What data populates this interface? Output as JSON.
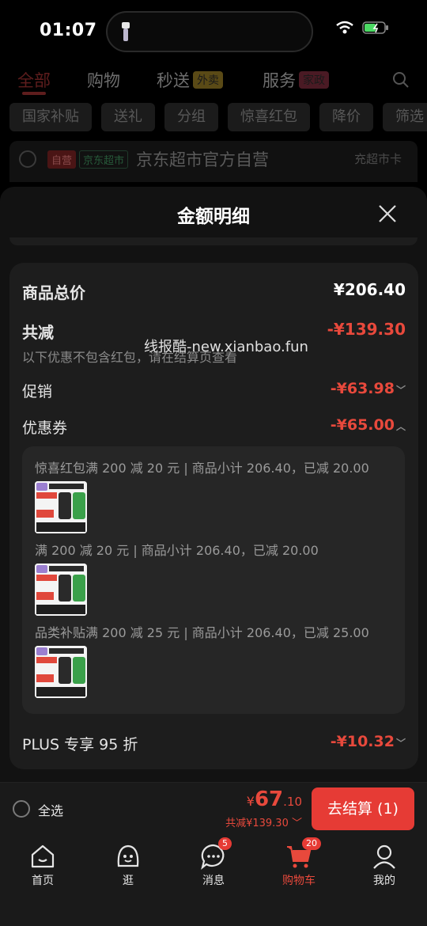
{
  "status_bar": {
    "time": "01:07"
  },
  "top_tabs": [
    {
      "label": "全部"
    },
    {
      "label": "购物"
    },
    {
      "label": "秒送",
      "badge": "外卖",
      "badge_color": "#c8a032"
    },
    {
      "label": "服务",
      "badge": "家政",
      "badge_color": "#b8374f"
    }
  ],
  "chips": [
    "国家补贴",
    "送礼",
    "分组",
    "惊喜红包",
    "降价",
    "筛选"
  ],
  "store": {
    "self_tag": "自营",
    "market_tag": "京东超市",
    "name": "京东超市官方自营",
    "card": "充超市卡"
  },
  "sheet": {
    "title": "金额明细",
    "goods_total_label": "商品总价",
    "goods_total_value": "¥206.40",
    "total_discount_label": "共减",
    "total_discount_value": "-¥139.30",
    "note": "以下优惠不包含红包，请在结算页查看",
    "promo_label": "促销",
    "promo_value": "-¥63.98",
    "coupon_label": "优惠券",
    "coupon_value": "-¥65.00",
    "coupons": [
      {
        "text": "惊喜红包满 200 减 20 元 | 商品小计 206.40，已减 20.00"
      },
      {
        "text": "满 200 减 20 元 | 商品小计 206.40，已减 20.00"
      },
      {
        "text": "品类补贴满 200 减 25 元 | 商品小计 206.40，已减 25.00"
      }
    ],
    "plus_label": "PLUS 专享 95 折",
    "plus_value": "-¥10.32"
  },
  "watermark": "线报酷-new.xianbao.fun",
  "checkout": {
    "select_all": "全选",
    "yen": "¥",
    "price_int": "67",
    "price_dec": ".10",
    "saved": "共减¥139.30",
    "pay_button": "去结算 (1)"
  },
  "tabbar": [
    {
      "label": "首页",
      "icon": "home-icon"
    },
    {
      "label": "逛",
      "icon": "explore-icon"
    },
    {
      "label": "消息",
      "icon": "message-icon",
      "badge": "5"
    },
    {
      "label": "购物车",
      "icon": "cart-icon",
      "badge": "20"
    },
    {
      "label": "我的",
      "icon": "profile-icon"
    }
  ],
  "colors": {
    "accent": "#e63b35",
    "discount": "#e8493c"
  }
}
